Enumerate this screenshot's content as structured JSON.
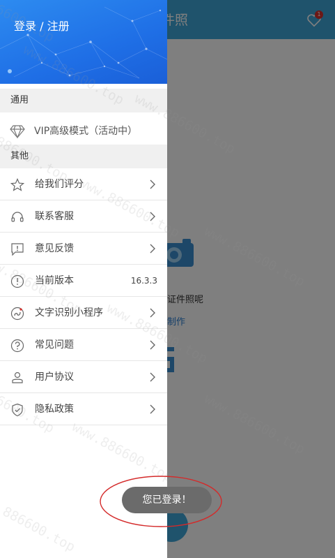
{
  "background": {
    "title_partial": "件照",
    "badge_count": "1",
    "prompt_text": "证件照呢",
    "link_text": "制作"
  },
  "drawer": {
    "login_label": "登录 / 注册",
    "sections": {
      "general": "通用",
      "other": "其他"
    },
    "vip_label": "VIP高级模式（活动中）",
    "items": [
      {
        "label": "给我们评分",
        "icon": "star-icon"
      },
      {
        "label": "联系客服",
        "icon": "headset-icon"
      },
      {
        "label": "意见反馈",
        "icon": "feedback-icon"
      },
      {
        "label": "当前版本",
        "icon": "info-icon",
        "value": "16.3.3"
      },
      {
        "label": "文字识别小程序",
        "icon": "mini-program-icon"
      },
      {
        "label": "常见问题",
        "icon": "question-icon"
      },
      {
        "label": "用户协议",
        "icon": "user-agreement-icon"
      },
      {
        "label": "隐私政策",
        "icon": "privacy-shield-icon"
      }
    ]
  },
  "toast": {
    "message": "您已登录！"
  },
  "watermark_text": "www.886600.top",
  "colors": {
    "header_blue": "#3fa6d8",
    "drawer_header_blue": "#1f6fe6",
    "annotation_red": "#d42a2a",
    "toast_bg": "#6b6b6b"
  }
}
